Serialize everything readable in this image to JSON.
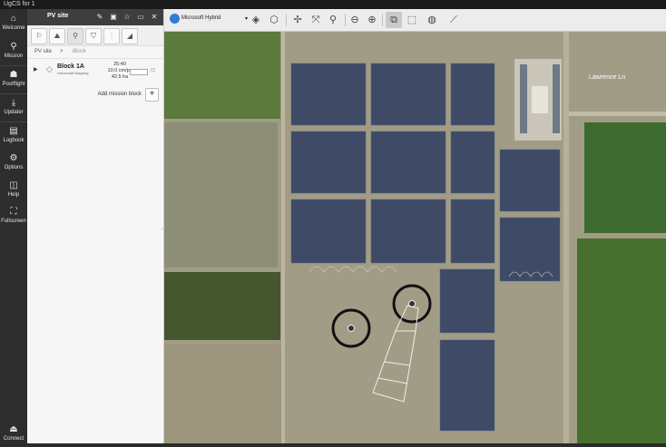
{
  "window": {
    "title": "UgCS for 1"
  },
  "rail": {
    "items": [
      {
        "label": "Welcome",
        "icon": "home-icon"
      },
      {
        "label": "Mission",
        "icon": "route-icon"
      },
      {
        "label": "Postflight",
        "icon": "stack-icon"
      },
      {
        "label": "Updater",
        "icon": "download-icon"
      },
      {
        "label": "Logbook",
        "icon": "book-icon"
      },
      {
        "label": "Options",
        "icon": "gear-icon"
      },
      {
        "label": "Help",
        "icon": "book-open-icon"
      },
      {
        "label": "Fullscreen",
        "icon": "expand-icon"
      },
      {
        "label": "Connect",
        "icon": "connect-icon"
      }
    ]
  },
  "panel": {
    "title": "PV site",
    "breadcrumb": {
      "root": "PV site",
      "separator": ">",
      "current": "Block"
    },
    "block": {
      "name": "Block 1A",
      "type": "Horizontal Mapping",
      "time": "25:40",
      "gsd": "10.0 cm/px",
      "area": "42.5 ha"
    },
    "add_label": "Add mission block"
  },
  "toolbar": {
    "map_provider": "Microsoft Hybrid"
  },
  "map": {
    "labels": {
      "road_name": "Lawrence Ln"
    }
  }
}
